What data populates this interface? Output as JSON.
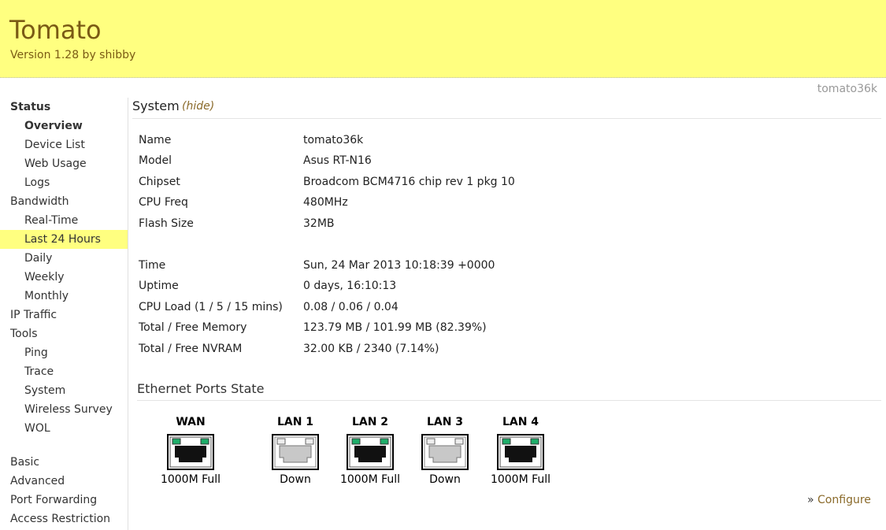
{
  "header": {
    "title": "Tomato",
    "version": "Version 1.28 by shibby"
  },
  "hostname": "tomato36k",
  "sidebar": {
    "items": [
      {
        "label": "Status"
      },
      {
        "label": "Overview"
      },
      {
        "label": "Device List"
      },
      {
        "label": "Web Usage"
      },
      {
        "label": "Logs"
      },
      {
        "label": "Bandwidth"
      },
      {
        "label": "Real-Time"
      },
      {
        "label": "Last 24 Hours"
      },
      {
        "label": "Daily"
      },
      {
        "label": "Weekly"
      },
      {
        "label": "Monthly"
      },
      {
        "label": "IP Traffic"
      },
      {
        "label": "Tools"
      },
      {
        "label": "Ping"
      },
      {
        "label": "Trace"
      },
      {
        "label": "System"
      },
      {
        "label": "Wireless Survey"
      },
      {
        "label": "WOL"
      },
      {
        "label": "Basic"
      },
      {
        "label": "Advanced"
      },
      {
        "label": "Port Forwarding"
      },
      {
        "label": "Access Restriction"
      }
    ],
    "active_color": "#ffff80"
  },
  "system": {
    "title": "System",
    "hide_label": "(hide)",
    "rows": [
      {
        "label": "Name",
        "value": "tomato36k"
      },
      {
        "label": "Model",
        "value": "Asus RT-N16"
      },
      {
        "label": "Chipset",
        "value": "Broadcom BCM4716 chip rev 1 pkg 10"
      },
      {
        "label": "CPU Freq",
        "value": "480MHz"
      },
      {
        "label": "Flash Size",
        "value": "32MB"
      },
      {
        "label": "Time",
        "value": "Sun, 24 Mar 2013 10:18:39 +0000"
      },
      {
        "label": "Uptime",
        "value": "0 days, 16:10:13"
      },
      {
        "label": "CPU Load (1 / 5 / 15 mins)",
        "value": "0.08 / 0.06 / 0.04"
      },
      {
        "label": "Total / Free Memory",
        "value": "123.79 MB / 101.99 MB (82.39%)"
      },
      {
        "label": "Total / Free NVRAM",
        "value": "32.00 KB / 2340 (7.14%)"
      }
    ]
  },
  "ethernet": {
    "title": "Ethernet Ports State",
    "ports": [
      {
        "name": "WAN",
        "status": "1000M Full",
        "connected": true
      },
      {
        "name": "LAN 1",
        "status": "Down",
        "connected": false
      },
      {
        "name": "LAN 2",
        "status": "1000M Full",
        "connected": true
      },
      {
        "name": "LAN 3",
        "status": "Down",
        "connected": false
      },
      {
        "name": "LAN 4",
        "status": "1000M Full",
        "connected": true
      }
    ],
    "configure_prefix": "»",
    "configure_label": "Configure"
  },
  "colors": {
    "header_bg": "#ffff80",
    "brand_text": "#7a5a14",
    "link": "#8a6a2a",
    "led_green": "#1fae6a"
  }
}
